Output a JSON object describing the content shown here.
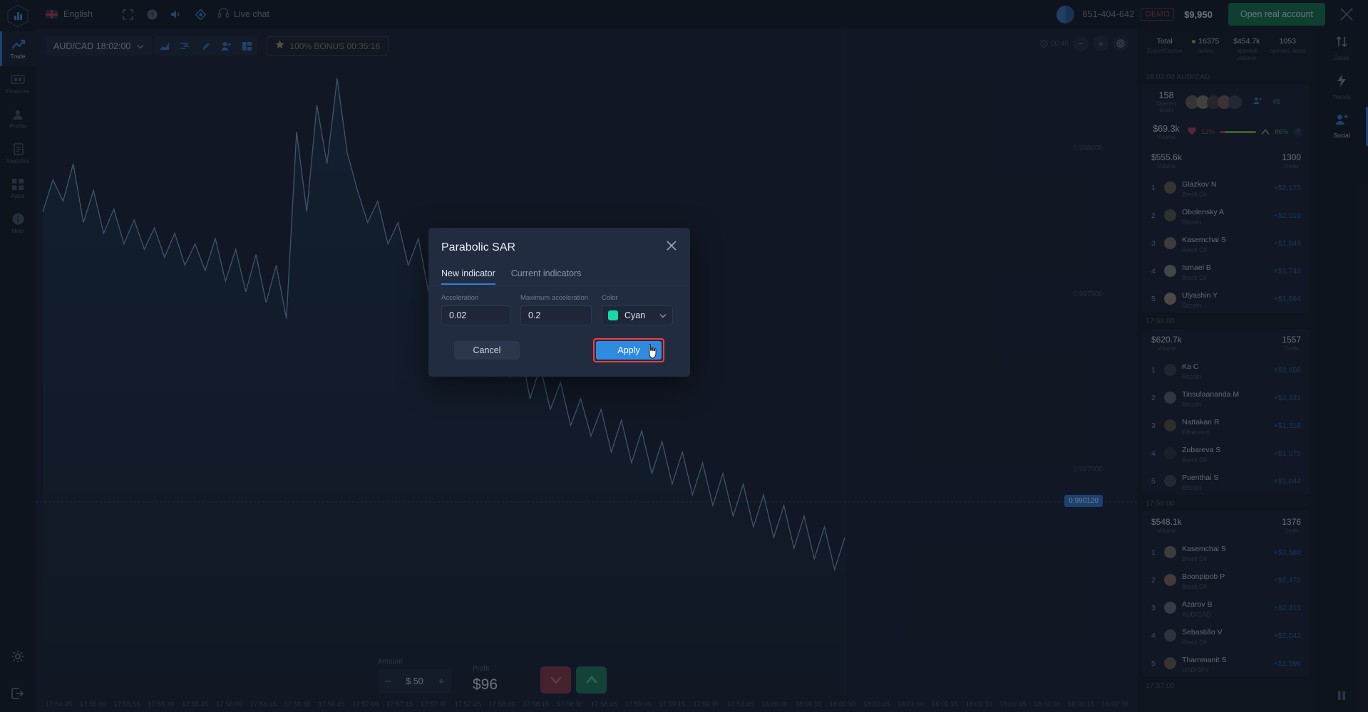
{
  "topbar": {
    "language": "English",
    "icons": [
      "fullscreen-icon",
      "help-circle-icon",
      "sound-icon",
      "settings-diamond-icon"
    ],
    "live_chat": "Live chat",
    "account_id": "651-404-642",
    "demo_badge": "DEMO",
    "balance": "$9,950",
    "open_real_account": "Open real account",
    "close": "close-icon"
  },
  "left_rail": {
    "logo": "expertoption-logo",
    "items": [
      {
        "label": "Trade",
        "icon": "trend-up-icon",
        "active": true
      },
      {
        "label": "Finances",
        "icon": "banknote-icon",
        "active": false
      },
      {
        "label": "Profile",
        "icon": "user-icon",
        "active": false
      },
      {
        "label": "Analytics",
        "icon": "document-icon",
        "active": false
      },
      {
        "label": "Apps",
        "icon": "grid-icon",
        "active": false
      },
      {
        "label": "Help",
        "icon": "info-icon",
        "active": false
      }
    ],
    "bottom": [
      {
        "label": "",
        "icon": "gear-icon"
      },
      {
        "label": "",
        "icon": "logout-icon"
      }
    ]
  },
  "chart": {
    "asset": "AUD/CAD 18:02:00",
    "toolbar_icons": [
      "chart-type-icon",
      "indicators-icon",
      "draw-pencil-icon",
      "add-trader-icon",
      "layout-icon"
    ],
    "bonus": "100% BONUS 00:35:16",
    "bonus_icon": "star-icon",
    "clock": "00:46",
    "current_price": "0.990120",
    "price_ticks": [
      "0.998000",
      "0.997500",
      "0.997000"
    ],
    "time_labels": [
      "17:54:45",
      "17:55:00",
      "17:55:15",
      "17:55:30",
      "17:55:45",
      "17:56:00",
      "17:56:15",
      "17:56:30",
      "17:56:45",
      "17:57:00",
      "17:57:15",
      "17:57:30",
      "17:57:45",
      "17:58:00",
      "17:58:15",
      "17:58:30",
      "17:58:45",
      "17:59:00",
      "17:59:15",
      "17:59:30",
      "17:59:45",
      "18:00:00",
      "18:00:15",
      "18:00:30",
      "18:00:45",
      "18:01:00",
      "18:01:15",
      "18:01:30",
      "18:01:45",
      "18:02:00",
      "18:02:15",
      "18:02:30"
    ]
  },
  "chart_data": {
    "type": "line",
    "title": "AUD/CAD",
    "xlabel": "",
    "ylabel": "",
    "x": [
      0,
      1,
      2,
      3,
      4,
      5,
      6,
      7,
      8,
      9,
      10,
      11,
      12,
      13,
      14,
      15,
      16,
      17,
      18,
      19,
      20,
      21,
      22,
      23,
      24,
      25,
      26,
      27,
      28,
      29,
      30,
      31,
      32,
      33,
      34,
      35,
      36,
      37,
      38,
      39,
      40,
      41,
      42,
      43,
      44,
      45,
      46,
      47,
      48,
      49,
      50,
      51,
      52,
      53,
      54,
      55,
      56,
      57,
      58,
      59,
      60,
      61,
      62,
      63,
      64,
      65,
      66,
      67,
      68,
      69,
      70,
      71,
      72,
      73,
      74,
      75,
      76,
      77,
      78,
      79
    ],
    "values": [
      100,
      112,
      104,
      118,
      96,
      108,
      92,
      101,
      88,
      97,
      86,
      94,
      83,
      92,
      80,
      88,
      78,
      90,
      74,
      86,
      70,
      84,
      66,
      80,
      60,
      130,
      100,
      140,
      118,
      150,
      122,
      108,
      96,
      104,
      88,
      96,
      80,
      90,
      70,
      82,
      62,
      74,
      54,
      66,
      46,
      60,
      38,
      50,
      30,
      42,
      26,
      36,
      20,
      30,
      16,
      26,
      10,
      22,
      6,
      18,
      2,
      14,
      -2,
      10,
      -6,
      6,
      -10,
      2,
      -14,
      -2,
      -18,
      -6,
      -22,
      -10,
      -26,
      -14,
      -30,
      -18,
      -34,
      -22
    ],
    "grid": false,
    "legend": false
  },
  "trade": {
    "amount_label": "Amount",
    "amount_value": "$ 50",
    "minus": "−",
    "plus": "+",
    "profit_label": "Profit",
    "profit_value": "$96",
    "down_button": "down-arrow-icon",
    "up_button": "up-arrow-icon"
  },
  "right_panel": {
    "stats": [
      {
        "value": "Total",
        "label": "ExpertOption",
        "dot": false
      },
      {
        "value": "16375",
        "label": "online",
        "dot": true
      },
      {
        "value": "$454.7k",
        "label": "opened volume",
        "dot": false
      },
      {
        "value": "1053",
        "label": "opened deals",
        "dot": false
      }
    ],
    "hero": {
      "timestamp": "18:02:00 AUD/CAD",
      "deals_value": "158",
      "deals_label": "Opened deals",
      "more_count": "45",
      "volume_value": "$69.3k",
      "volume_label": "Volume",
      "pct_down": "12%",
      "pct_up": "86%",
      "help_icon": "question-icon"
    },
    "boards": [
      {
        "timestamp": "",
        "volume": "$555.6k",
        "volume_label": "Volume",
        "deals": "1300",
        "deals_label": "Deals",
        "rows": [
          {
            "rank": "1",
            "name": "Glazkov N",
            "asset": "Brent Oil",
            "amount": "+$2,175"
          },
          {
            "rank": "2",
            "name": "Obolensky A",
            "asset": "Bitcoin",
            "amount": "+$2,019"
          },
          {
            "rank": "3",
            "name": "Kasemchai S",
            "asset": "Brent Oil",
            "amount": "+$1,849"
          },
          {
            "rank": "4",
            "name": "Ismael B",
            "asset": "Brent Oil",
            "amount": "+$1,740"
          },
          {
            "rank": "5",
            "name": "Ulyashin Y",
            "asset": "Bitcoin",
            "amount": "+$1,594"
          }
        ]
      },
      {
        "timestamp": "17:59:00",
        "volume": "$620.7k",
        "volume_label": "Volume",
        "deals": "1557",
        "deals_label": "Deals",
        "rows": [
          {
            "rank": "1",
            "name": "Ka C",
            "asset": "Bitcoin",
            "amount": "+$2,656"
          },
          {
            "rank": "2",
            "name": "Tinsulaananda M",
            "asset": "Bitcoin",
            "amount": "+$2,231"
          },
          {
            "rank": "3",
            "name": "Nattakan R",
            "asset": "Ethereum",
            "amount": "+$1,316"
          },
          {
            "rank": "4",
            "name": "Zubareva S",
            "asset": "Brent Oil",
            "amount": "+$1,075"
          },
          {
            "rank": "5",
            "name": "Puenthai S",
            "asset": "Bitcoin",
            "amount": "+$1,044"
          }
        ]
      },
      {
        "timestamp": "17:58:00",
        "volume": "$548.1k",
        "volume_label": "Volume",
        "deals": "1376",
        "deals_label": "Deals",
        "rows": [
          {
            "rank": "1",
            "name": "Kasemchai S",
            "asset": "Brent Oil",
            "amount": "+$2,580"
          },
          {
            "rank": "2",
            "name": "Boonpipob P",
            "asset": "Brent Oil",
            "amount": "+$2,472"
          },
          {
            "rank": "3",
            "name": "Azarov B",
            "asset": "AUD/CAD",
            "amount": "+$2,415"
          },
          {
            "rank": "4",
            "name": "Sebastião V",
            "asset": "Brent Oil",
            "amount": "+$2,042"
          },
          {
            "rank": "5",
            "name": "Thammanit S",
            "asset": "USD/JPY",
            "amount": "+$1,596"
          }
        ]
      }
    ],
    "last_timestamp": "17:57:00"
  },
  "far_rail": {
    "items": [
      {
        "label": "Deals",
        "icon": "arrows-updown-icon",
        "active": false
      },
      {
        "label": "Trends",
        "icon": "lightning-icon",
        "active": false
      },
      {
        "label": "Social",
        "icon": "add-person-icon",
        "active": true
      }
    ],
    "pause": "pause-icon"
  },
  "modal": {
    "title": "Parabolic SAR",
    "close_icon": "close-icon",
    "tabs": [
      {
        "label": "New indicator",
        "active": true
      },
      {
        "label": "Current indicators",
        "active": false
      }
    ],
    "fields": {
      "acceleration_label": "Acceleration",
      "acceleration_value": "0.02",
      "max_acceleration_label": "Maximum acceleration",
      "max_acceleration_value": "0.2",
      "color_label": "Color",
      "color_name": "Cyan",
      "color_hex": "#17d9a8"
    },
    "cancel_label": "Cancel",
    "apply_label": "Apply",
    "highlight_color": "#ff3b3b"
  }
}
